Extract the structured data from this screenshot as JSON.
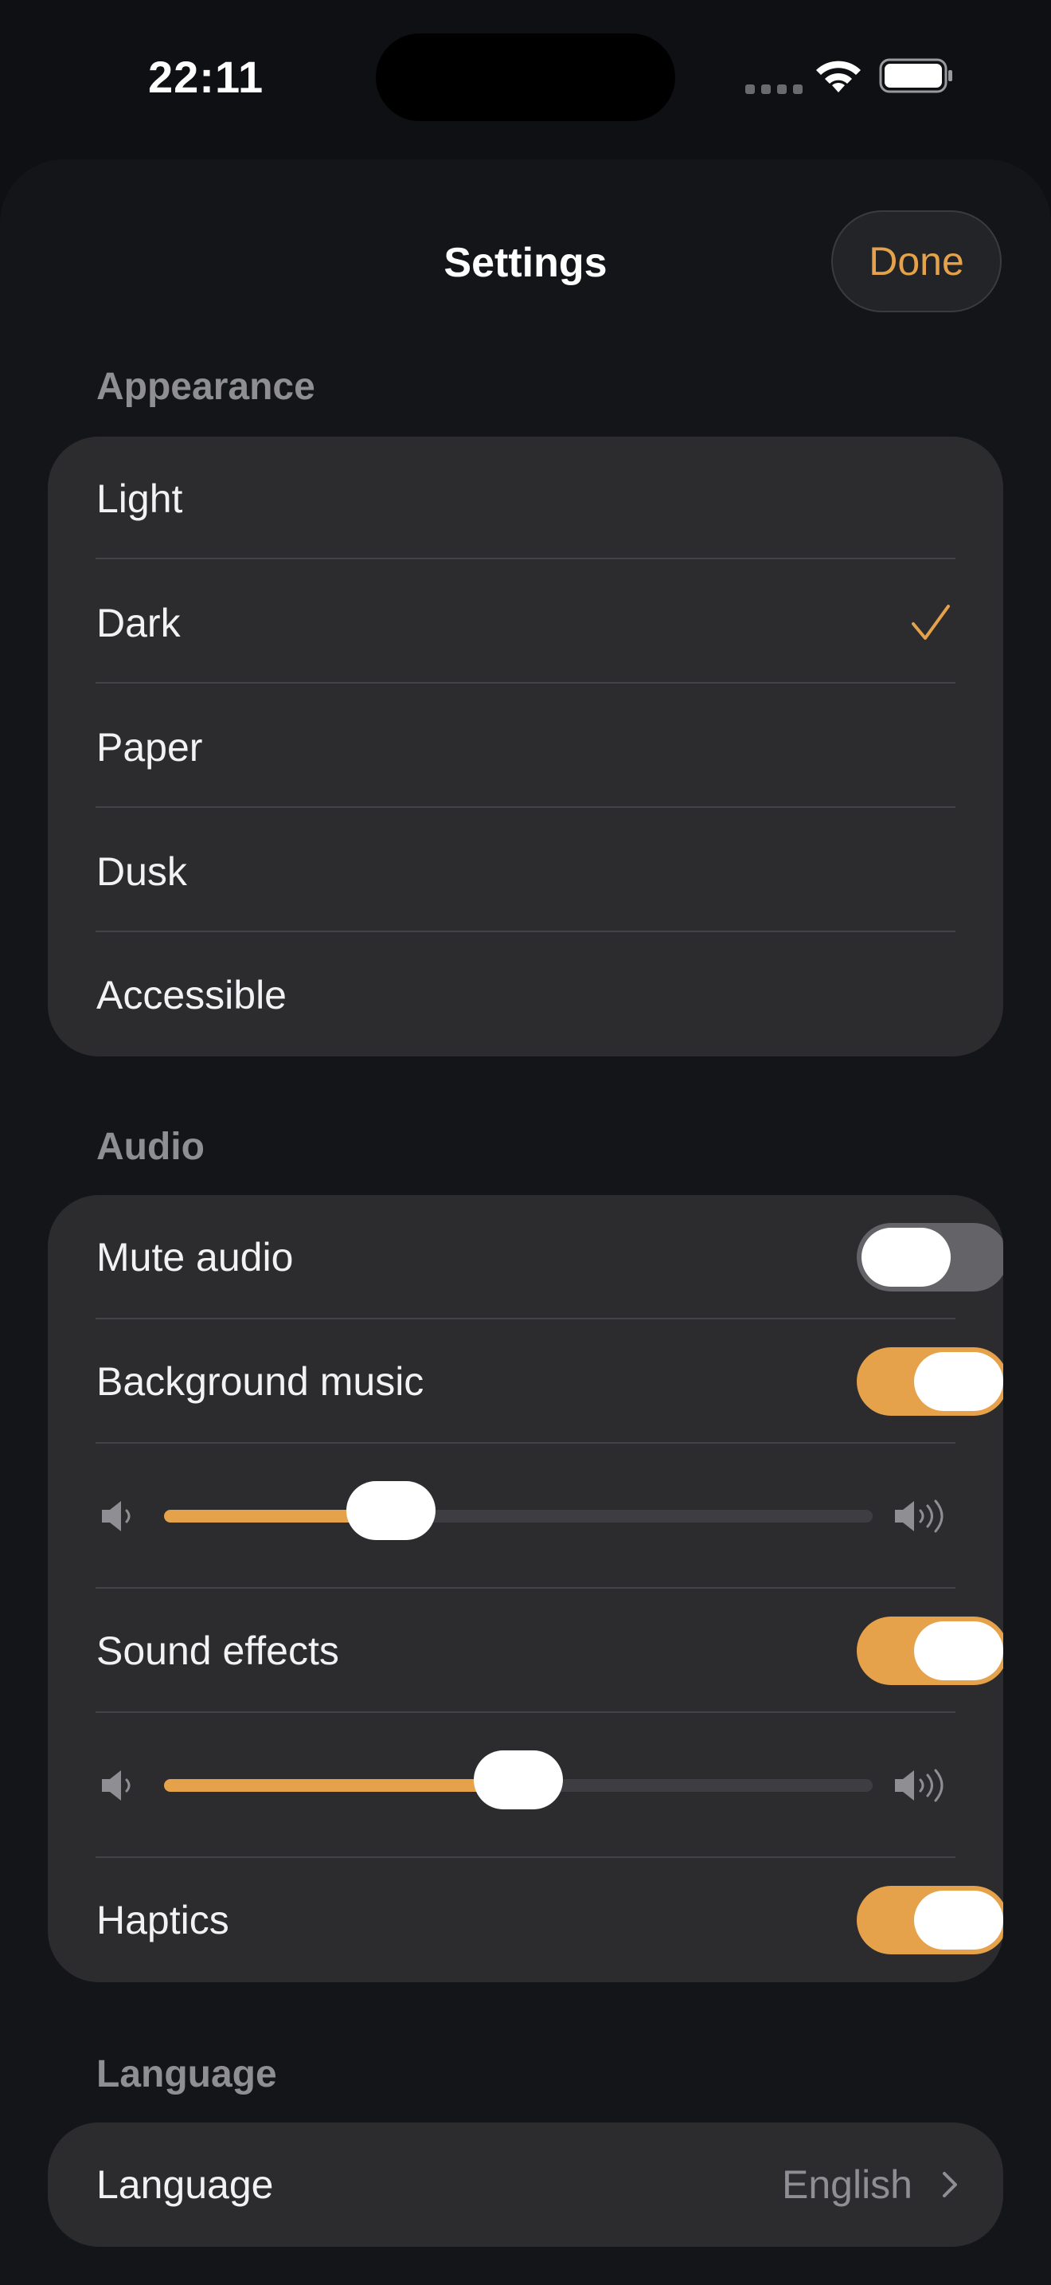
{
  "status_bar": {
    "time": "22:11"
  },
  "header": {
    "title": "Settings",
    "done_label": "Done"
  },
  "appearance": {
    "header": "Appearance",
    "options": [
      "Light",
      "Dark",
      "Paper",
      "Dusk",
      "Accessible"
    ],
    "selected": "Dark"
  },
  "audio": {
    "header": "Audio",
    "mute_label": "Mute audio",
    "mute_on": false,
    "music_label": "Background music",
    "music_on": true,
    "music_volume": 0.32,
    "effects_label": "Sound effects",
    "effects_on": true,
    "effects_volume": 0.5,
    "haptics_label": "Haptics",
    "haptics_on": true
  },
  "language": {
    "header": "Language",
    "row_label": "Language",
    "value": "English"
  },
  "colors": {
    "accent": "#e5a24a",
    "background": "#141518",
    "group": "#2c2c2f"
  },
  "icons": [
    "wifi-icon",
    "battery-icon",
    "checkmark-icon",
    "speaker-low-icon",
    "speaker-high-icon",
    "chevron-right-icon"
  ]
}
